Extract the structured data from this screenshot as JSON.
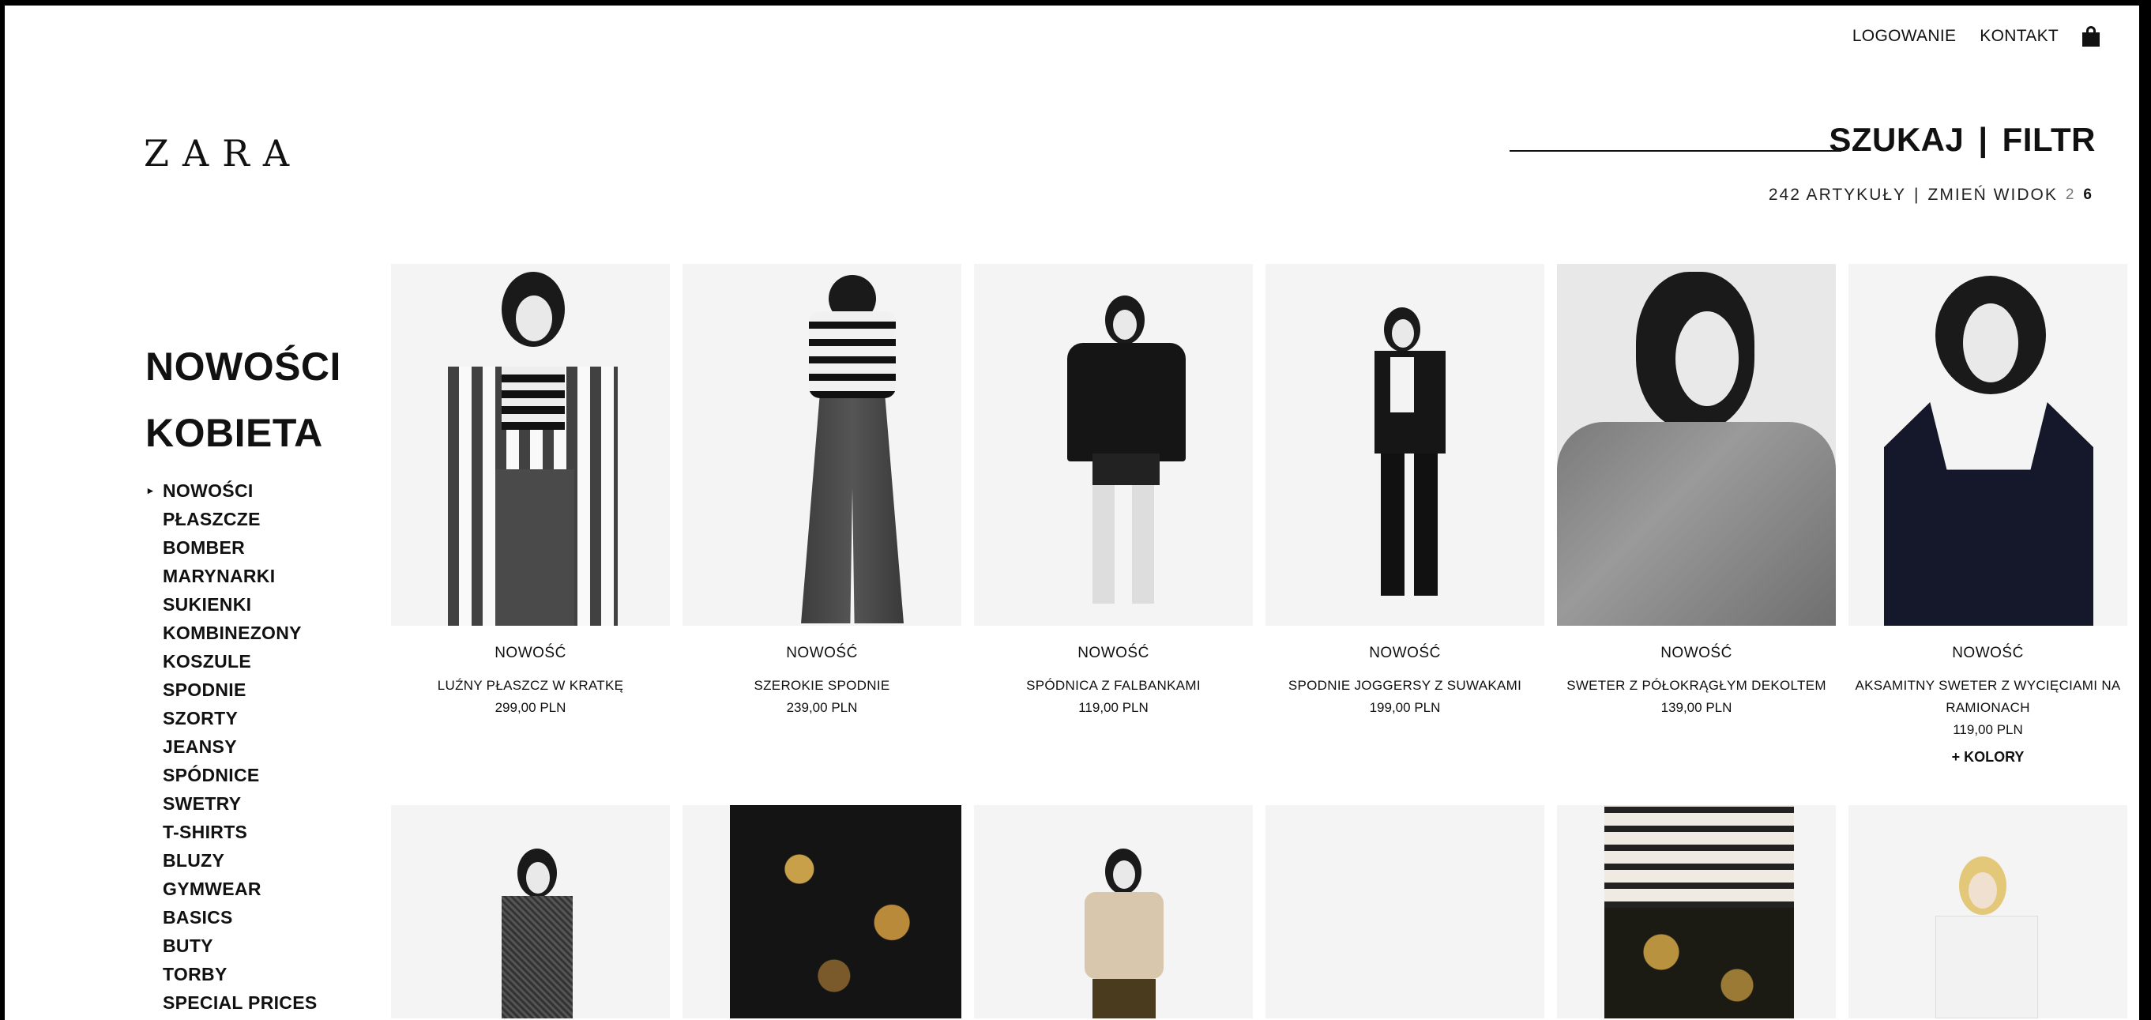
{
  "header": {
    "login": "LOGOWANIE",
    "contact": "KONTAKT",
    "logo": "ZARA",
    "search": "SZUKAJ",
    "separator": "|",
    "filter": "FILTR",
    "count_text": "242 ARTYKUŁY",
    "change_view": "ZMIEŃ WIDOK",
    "view_options": [
      "2",
      "6"
    ],
    "active_view": "6"
  },
  "sidebar": {
    "title_1": "NOWOŚCI",
    "title_2": "KOBIETA",
    "items": [
      "NOWOŚCI",
      "PŁASZCZE",
      "BOMBER",
      "MARYNARKI",
      "SUKIENKI",
      "KOMBINEZONY",
      "KOSZULE",
      "SPODNIE",
      "SZORTY",
      "JEANSY",
      "SPÓDNICE",
      "SWETRY",
      "T-SHIRTS",
      "BLUZY",
      "GYMWEAR",
      "BASICS",
      "BUTY",
      "TORBY",
      "SPECIAL PRICES"
    ],
    "active_index": 0
  },
  "products": [
    {
      "tag": "NOWOŚĆ",
      "name": "LUŹNY PŁASZCZ W KRATKĘ",
      "price": "299,00 PLN",
      "extra": ""
    },
    {
      "tag": "NOWOŚĆ",
      "name": "SZEROKIE SPODNIE",
      "price": "239,00 PLN",
      "extra": ""
    },
    {
      "tag": "NOWOŚĆ",
      "name": "SPÓDNICA Z FALBANKAMI",
      "price": "119,00 PLN",
      "extra": ""
    },
    {
      "tag": "NOWOŚĆ",
      "name": "SPODNIE JOGGERSY Z SUWAKAMI",
      "price": "199,00 PLN",
      "extra": ""
    },
    {
      "tag": "NOWOŚĆ",
      "name": "SWETER Z PÓŁOKRĄGŁYM DEKOLTEM",
      "price": "139,00 PLN",
      "extra": ""
    },
    {
      "tag": "NOWOŚĆ",
      "name": "AKSAMITNY SWETER Z WYCIĘCIAMI NA RAMIONACH",
      "price": "119,00 PLN",
      "extra": "+ KOLORY"
    }
  ],
  "icons": {
    "bag": "shopping-bag-icon",
    "bullet": "▸"
  }
}
